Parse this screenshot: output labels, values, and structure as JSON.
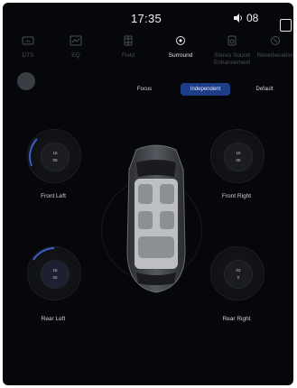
{
  "status": {
    "time": "17:35",
    "indicator_value": "08"
  },
  "tabs": [
    {
      "label": "DTS",
      "icon": "dts-icon"
    },
    {
      "label": "EQ",
      "icon": "eq-icon"
    },
    {
      "label": "Field",
      "icon": "field-icon"
    },
    {
      "label": "Surround",
      "icon": "surround-icon",
      "active": true
    },
    {
      "label": "Stereo Sound Enhancement",
      "icon": "stereo-icon"
    },
    {
      "label": "Reverberation",
      "icon": "reverb-icon"
    }
  ],
  "modes": {
    "focus": "Focus",
    "independent": "Independent",
    "default": "Default",
    "selected": "Independent"
  },
  "speakers": {
    "front_left": {
      "label": "Front Left",
      "value1": "16",
      "value2": "08"
    },
    "front_right": {
      "label": "Front Right",
      "value1": "16",
      "value2": "05"
    },
    "rear_left": {
      "label": "Rear Left",
      "value1": "16",
      "value2": "02"
    },
    "rear_right": {
      "label": "Rear Right",
      "value1": "02",
      "value2": "0"
    }
  },
  "colors": {
    "background": "#06070b",
    "accent": "#1d3d87",
    "arc": "#3a5fc8"
  }
}
